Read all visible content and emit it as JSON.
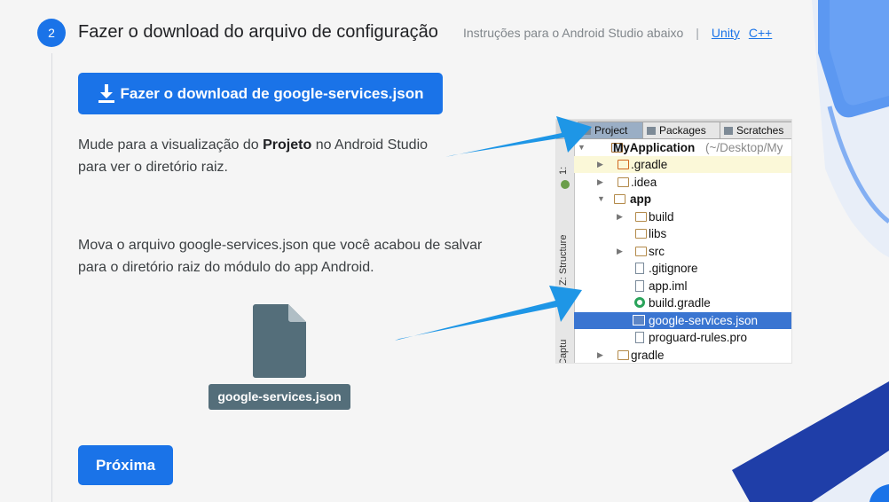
{
  "step": {
    "number": "2",
    "title": "Fazer o download do arquivo de configuração",
    "instructions_text": "Instruções para o Android Studio abaixo",
    "separator": "|",
    "links": [
      "Unity",
      "C++"
    ]
  },
  "download_button": {
    "label": "Fazer o download de google-services.json",
    "icon": "download-icon"
  },
  "paragraph1": {
    "pre": "Mude para a visualização do ",
    "bold": "Projeto",
    "post": " no Android Studio para ver o diretório raiz."
  },
  "paragraph2": "Mova o arquivo google-services.json que você acabou de salvar para o diretório raiz do módulo do app Android.",
  "file_label": "google-services.json",
  "next_button": "Próxima",
  "studio_screenshot": {
    "tabs": [
      "Project",
      "Packages",
      "Scratches"
    ],
    "side_tabs": [
      "1:",
      "Z: Structure",
      "Captu"
    ],
    "tree": [
      {
        "label": "MyApplication",
        "suffix": "(~/Desktop/My",
        "bold": true,
        "arrow": "▼",
        "icon": "project-folder-icon"
      },
      {
        "label": ".gradle",
        "arrow": "▶",
        "icon": "folder-icon"
      },
      {
        "label": ".idea",
        "arrow": "▶",
        "icon": "folder-icon"
      },
      {
        "label": "app",
        "bold": true,
        "arrow": "▼",
        "icon": "module-folder-icon"
      },
      {
        "label": "build",
        "arrow": "▶",
        "icon": "folder-icon"
      },
      {
        "label": "libs",
        "arrow": "",
        "icon": "folder-icon"
      },
      {
        "label": "src",
        "arrow": "▶",
        "icon": "folder-icon"
      },
      {
        "label": ".gitignore",
        "arrow": "",
        "icon": "file-icon"
      },
      {
        "label": "app.iml",
        "arrow": "",
        "icon": "file-icon"
      },
      {
        "label": "build.gradle",
        "arrow": "",
        "icon": "gradle-icon"
      },
      {
        "label": "google-services.json",
        "arrow": "",
        "icon": "json-file-icon",
        "selected": true
      },
      {
        "label": "proguard-rules.pro",
        "arrow": "",
        "icon": "file-icon"
      },
      {
        "label": "gradle",
        "arrow": "▶",
        "icon": "folder-icon"
      }
    ]
  },
  "colors": {
    "accent": "#1a73e8",
    "file_tag": "#546e7a",
    "arrow": "#1e96e6",
    "selection": "#3a75d1"
  }
}
